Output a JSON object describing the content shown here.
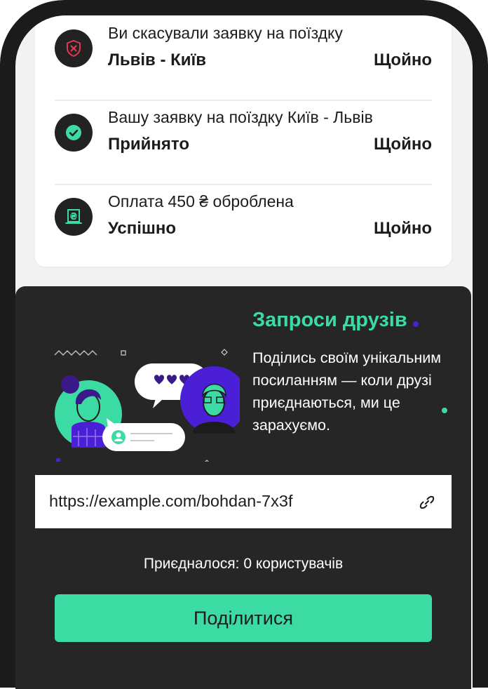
{
  "notifications": [
    {
      "icon": "cancel-shield-icon",
      "title": "Ви скасували заявку на поїздку",
      "subtitle": "Львів - Київ",
      "time": "Щойно"
    },
    {
      "icon": "check-circle-icon",
      "title": "Вашу заявку на поїздку Київ - Львів",
      "subtitle": "Прийнято",
      "time": "Щойно"
    },
    {
      "icon": "hryvnia-receipt-icon",
      "title": "Оплата 450 ₴ оброблена",
      "subtitle": "Успішно",
      "time": "Щойно"
    }
  ],
  "invite": {
    "title": "Запроси друзів",
    "description": "Поділись своїм унікальним посиланням — коли друзі приєднаються, ми це зарахуємо.",
    "referral_link": "https://example.com/bohdan-7x3f",
    "joined_text": "Приєдналося: 0 користувачів",
    "share_label": "Поділитися"
  },
  "colors": {
    "accent": "#3ddba4",
    "panel": "#262626",
    "purple": "#4a1fd6",
    "danger": "#e03a4e"
  }
}
